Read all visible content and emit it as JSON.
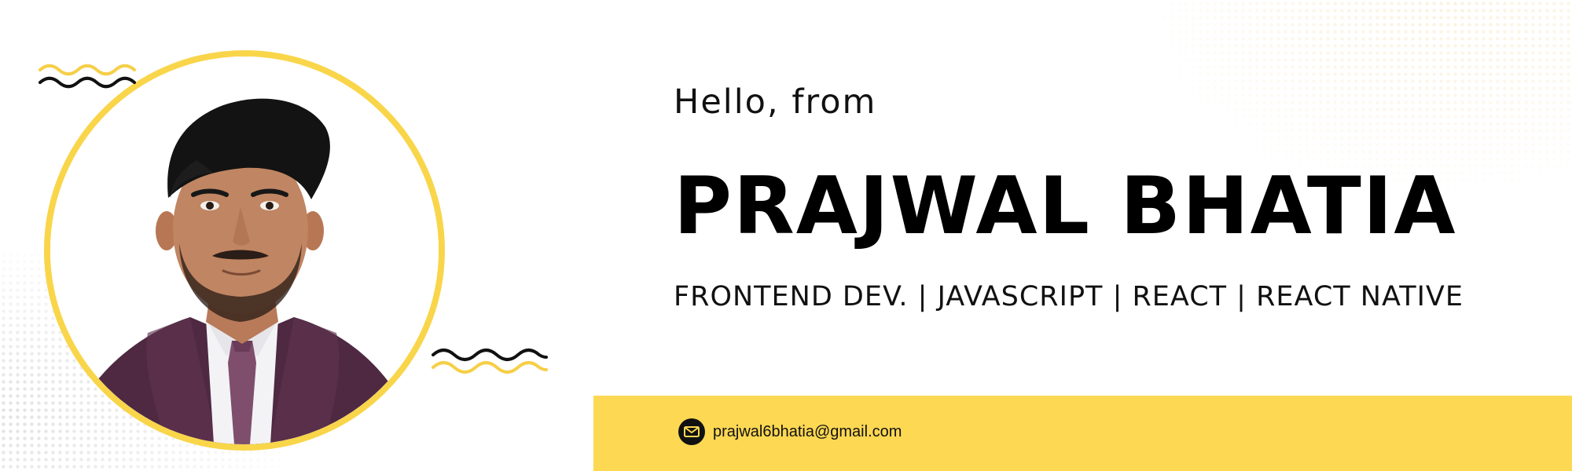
{
  "banner": {
    "greeting": "Hello, from",
    "name": "PRAJWAL BHATIA",
    "roles": "FRONTEND DEV. | JAVASCRIPT | REACT | REACT NATIVE"
  },
  "contact": {
    "email": "prajwal6bhatia@gmail.com",
    "icon": "mail-icon"
  },
  "colors": {
    "accent": "#fdd853",
    "ring": "#f9d54a",
    "text": "#111111"
  }
}
